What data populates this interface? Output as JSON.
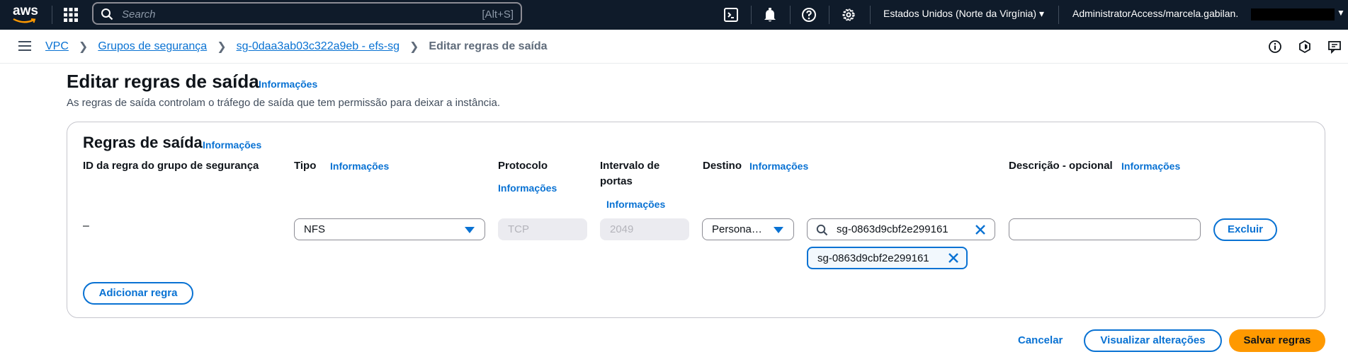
{
  "topbar": {
    "logo_text": "aws",
    "search_placeholder": "Search",
    "search_shortcut": "[Alt+S]",
    "region": "Estados Unidos (Norte da Virgínia) ▾",
    "account": "AdministratorAccess/marcela.gabilan.",
    "icons": [
      "grid-icon",
      "cloudshell-icon",
      "bell-icon",
      "help-icon",
      "settings-icon"
    ]
  },
  "breadcrumb": {
    "items": [
      "VPC",
      "Grupos de segurança",
      "sg-0daa3ab03c322a9eb - efs-sg"
    ],
    "current": "Editar regras de saída"
  },
  "page": {
    "title": "Editar regras de saída",
    "title_info": "Informações",
    "description": "As regras de saída controlam o tráfego de saída que tem permissão para deixar a instância."
  },
  "panel": {
    "title": "Regras de saída",
    "info": "Informações",
    "columns": {
      "rule_id": "ID da regra do grupo de segurança",
      "type": "Tipo",
      "type_info": "Informações",
      "protocol": "Protocolo",
      "protocol_info": "Informações",
      "port_range_line1": "Intervalo de",
      "port_range_line2": "portas",
      "port_range_info": "Informações",
      "destination": "Destino",
      "destination_info": "Informações",
      "description": "Descrição - opcional",
      "description_info": "Informações"
    },
    "rule": {
      "id": "–",
      "type": "NFS",
      "protocol": "TCP",
      "port_range": "2049",
      "destination_type": "Persona…",
      "destination_search": "sg-0863d9cbf2e299161",
      "destination_token": "sg-0863d9cbf2e299161",
      "description": "",
      "delete_label": "Excluir"
    },
    "add_rule_label": "Adicionar regra"
  },
  "footer": {
    "cancel": "Cancelar",
    "preview": "Visualizar alterações",
    "save": "Salvar regras"
  },
  "colors": {
    "topbar_bg": "#0f1b2a",
    "link": "#0972d3",
    "primary": "#ff9900"
  }
}
